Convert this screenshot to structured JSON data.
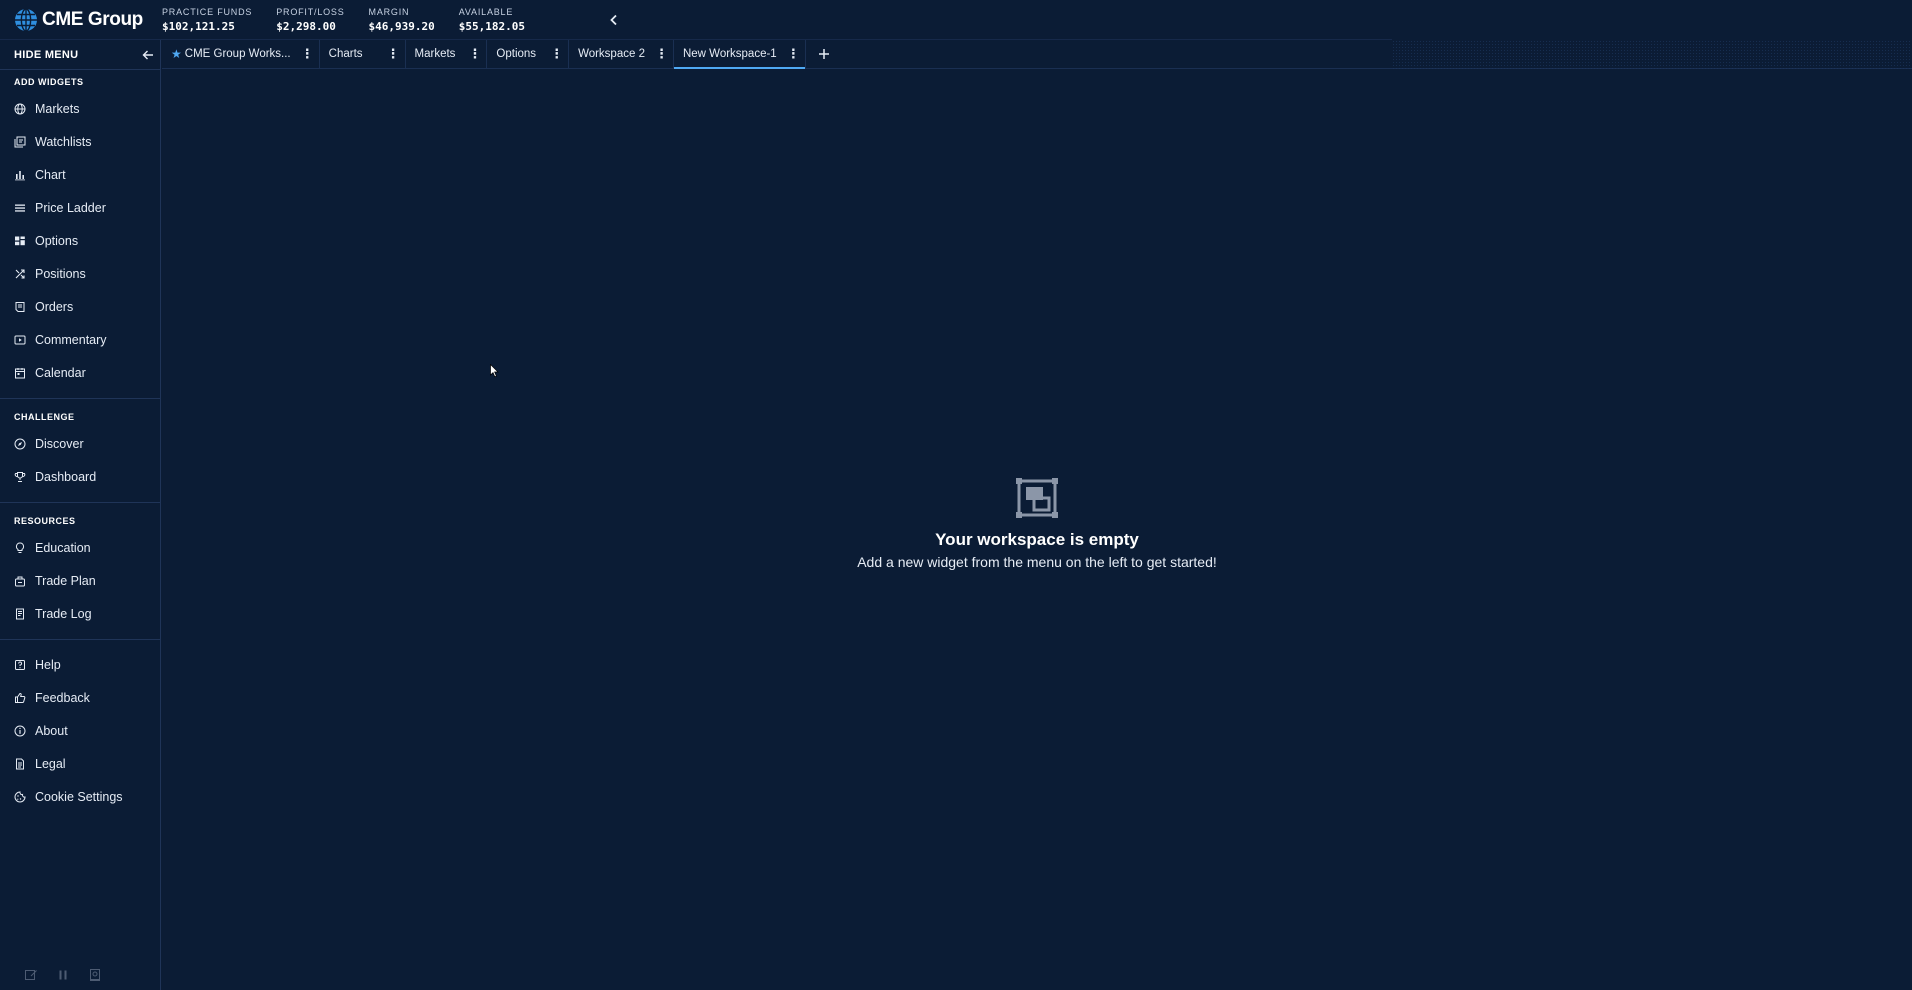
{
  "header": {
    "brand": "CME Group",
    "stats": [
      {
        "label": "PRACTICE FUNDS",
        "value": "$102,121.25"
      },
      {
        "label": "PROFIT/LOSS",
        "value": "$2,298.00"
      },
      {
        "label": "MARGIN",
        "value": "$46,939.20"
      },
      {
        "label": "AVAILABLE",
        "value": "$55,182.05"
      }
    ]
  },
  "sidebar": {
    "hide_menu_label": "HIDE MENU",
    "sections": {
      "add_widgets": "ADD WIDGETS",
      "challenge": "CHALLENGE",
      "resources": "RESOURCES"
    },
    "widgets": [
      {
        "label": "Markets",
        "icon": "globe-icon"
      },
      {
        "label": "Watchlists",
        "icon": "watchlist-icon"
      },
      {
        "label": "Chart",
        "icon": "bar-chart-icon"
      },
      {
        "label": "Price Ladder",
        "icon": "ladder-icon"
      },
      {
        "label": "Options",
        "icon": "options-icon"
      },
      {
        "label": "Positions",
        "icon": "positions-icon"
      },
      {
        "label": "Orders",
        "icon": "orders-icon"
      },
      {
        "label": "Commentary",
        "icon": "video-icon"
      },
      {
        "label": "Calendar",
        "icon": "calendar-icon"
      }
    ],
    "challenge": [
      {
        "label": "Discover",
        "icon": "compass-icon"
      },
      {
        "label": "Dashboard",
        "icon": "trophy-icon"
      }
    ],
    "resources": [
      {
        "label": "Education",
        "icon": "lightbulb-icon"
      },
      {
        "label": "Trade Plan",
        "icon": "trade-plan-icon"
      },
      {
        "label": "Trade Log",
        "icon": "trade-log-icon"
      }
    ],
    "misc": [
      {
        "label": "Help",
        "icon": "help-icon"
      },
      {
        "label": "Feedback",
        "icon": "thumbs-up-icon"
      },
      {
        "label": "About",
        "icon": "info-icon"
      },
      {
        "label": "Legal",
        "icon": "document-icon"
      },
      {
        "label": "Cookie Settings",
        "icon": "cookie-icon"
      }
    ]
  },
  "tabs": [
    {
      "label": "CME Group Works...",
      "starred": true,
      "active": false
    },
    {
      "label": "Charts",
      "starred": false,
      "active": false
    },
    {
      "label": "Markets",
      "starred": false,
      "active": false
    },
    {
      "label": "Options",
      "starred": false,
      "active": false
    },
    {
      "label": "Workspace 2",
      "starred": false,
      "active": false
    },
    {
      "label": "New Workspace-1",
      "starred": false,
      "active": true
    }
  ],
  "workspace": {
    "empty_title": "Your workspace is empty",
    "empty_subtitle": "Add a new widget from the menu on the left to get started!"
  },
  "colors": {
    "background": "#0b1c35",
    "accent": "#4fa9f4",
    "divider": "#1f3458"
  }
}
